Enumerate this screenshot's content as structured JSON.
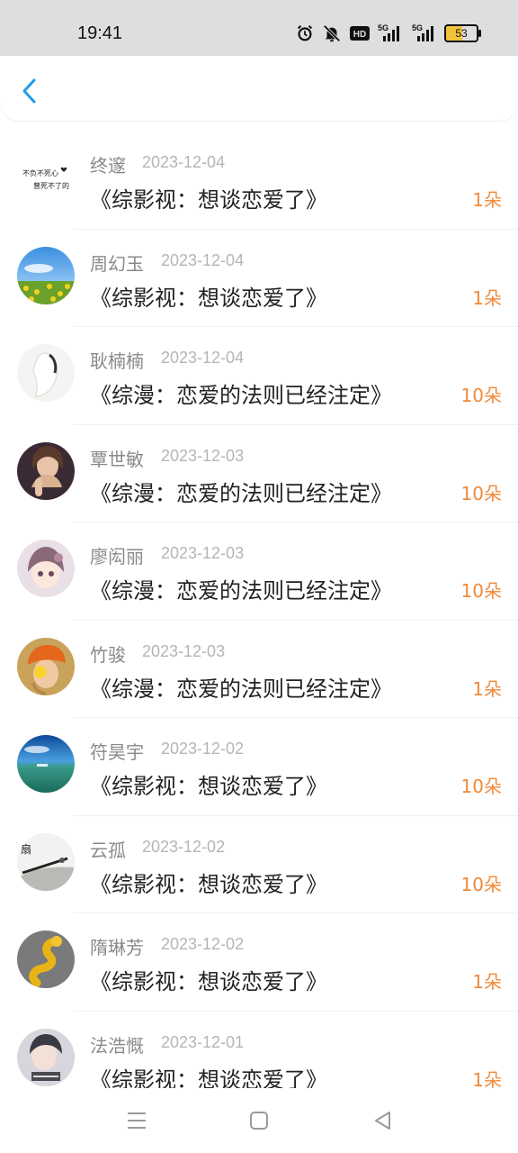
{
  "status_bar": {
    "time": "19:41",
    "hd_label": "HD",
    "signal1_label": "5G",
    "signal2_label": "5G",
    "battery": "53"
  },
  "header": {
    "back_icon": "chevron-left-icon"
  },
  "records": [
    {
      "name": "终邃",
      "date": "2023-12-04",
      "title": "《综影视：想谈恋爱了》",
      "amount": "1朵",
      "avatar": "avatar-text-image"
    },
    {
      "name": "周幻玉",
      "date": "2023-12-04",
      "title": "《综影视：想谈恋爱了》",
      "amount": "1朵",
      "avatar": "avatar-sky-field"
    },
    {
      "name": "耿楠楠",
      "date": "2023-12-04",
      "title": "《综漫：恋爱的法则已经注定》",
      "amount": "10朵",
      "avatar": "avatar-white-figure"
    },
    {
      "name": "覃世敏",
      "date": "2023-12-03",
      "title": "《综漫：恋爱的法则已经注定》",
      "amount": "10朵",
      "avatar": "avatar-girl-praying"
    },
    {
      "name": "廖闳丽",
      "date": "2023-12-03",
      "title": "《综漫：恋爱的法则已经注定》",
      "amount": "10朵",
      "avatar": "avatar-anime-girl"
    },
    {
      "name": "竹骏",
      "date": "2023-12-03",
      "title": "《综漫：恋爱的法则已经注定》",
      "amount": "1朵",
      "avatar": "avatar-orange-hat"
    },
    {
      "name": "符昊宇",
      "date": "2023-12-02",
      "title": "《综影视：想谈恋爱了》",
      "amount": "10朵",
      "avatar": "avatar-ocean"
    },
    {
      "name": "云孤",
      "date": "2023-12-02",
      "title": "《综影视：想谈恋爱了》",
      "amount": "10朵",
      "avatar": "avatar-ink-painting"
    },
    {
      "name": "隋琳芳",
      "date": "2023-12-02",
      "title": "《综影视：想谈恋爱了》",
      "amount": "1朵",
      "avatar": "avatar-gold-snake"
    },
    {
      "name": "法浩慨",
      "date": "2023-12-01",
      "title": "《综影视：想谈恋爱了》",
      "amount": "1朵",
      "avatar": "avatar-child-photo"
    }
  ],
  "colors": {
    "amount": "#f08a3a",
    "accent": "#1e9be8",
    "name": "#8a8a8a",
    "date": "#b5b5b5",
    "title": "#222222"
  },
  "nav": {
    "menu_icon": "menu-icon",
    "home_icon": "home-square-icon",
    "back_icon": "back-triangle-icon"
  }
}
